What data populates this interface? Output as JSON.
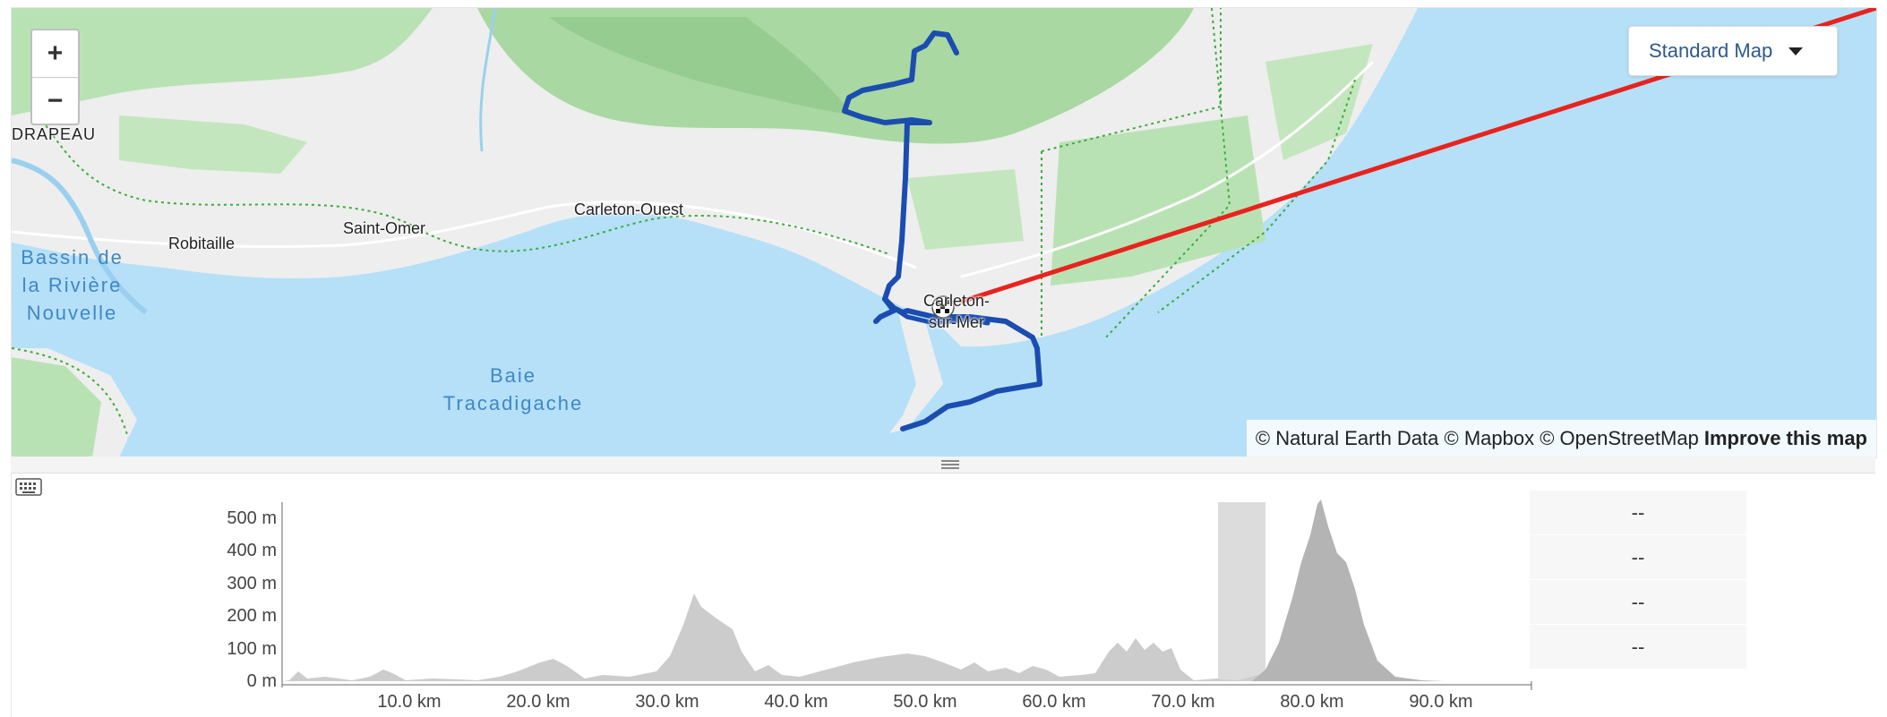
{
  "map": {
    "zoom_in": "+",
    "zoom_out": "−",
    "map_type": "Standard Map",
    "places": {
      "drapeau": "DRAPEAU",
      "robitaille": "Robitaille",
      "saint_omer": "Saint-Omer",
      "carleton_ouest": "Carleton-Ouest",
      "carleton_sur_mer": "Carleton-\nsur-Mer"
    },
    "water": {
      "bassin": "Bassin de\nla Rivière\nNouvelle",
      "baie": "Baie\nTracadigache"
    },
    "attribution": {
      "text": "© Natural Earth Data © Mapbox © OpenStreetMap",
      "improve": "Improve this map"
    },
    "colors": {
      "water": "#b5e0f8",
      "land": "#eeeeee",
      "forest": "#b9e2b4",
      "route": "#1b4db0",
      "straight_line": "#e8231e"
    }
  },
  "elevation": {
    "y_ticks": [
      "500 m",
      "400 m",
      "300 m",
      "200 m",
      "100 m",
      "0 m"
    ],
    "x_ticks": [
      "10.0 km",
      "20.0 km",
      "30.0 km",
      "40.0 km",
      "50.0 km",
      "60.0 km",
      "70.0 km",
      "80.0 km",
      "90.0 km"
    ],
    "stats": [
      "--",
      "--",
      "--",
      "--"
    ],
    "icons": {
      "keyboard": "keyboard-icon",
      "grip": "resize-grip-icon"
    }
  }
}
